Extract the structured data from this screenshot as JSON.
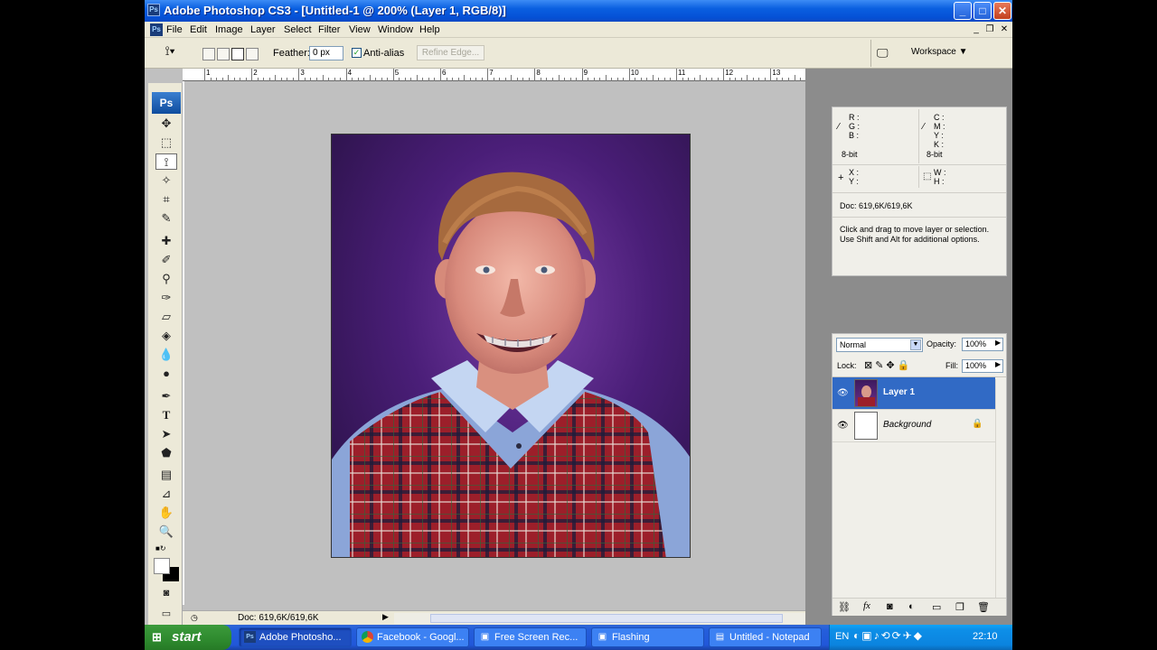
{
  "window": {
    "title": "Adobe Photoshop CS3 - [Untitled-1 @ 200% (Layer 1, RGB/8)]",
    "app_icon": "Ps",
    "minimize": "_",
    "maximize": "□",
    "close": "✕"
  },
  "menu": {
    "items": [
      "File",
      "Edit",
      "Image",
      "Layer",
      "Select",
      "Filter",
      "View",
      "Window",
      "Help"
    ],
    "doc_controls": [
      "_",
      "❐",
      "✕"
    ]
  },
  "options": {
    "feather_label": "Feather:",
    "feather_value": "0 px",
    "antialias_label": "Anti-alias",
    "antialias_checked": true,
    "refine_edge": "Refine Edge...",
    "workspace": "Workspace ▼"
  },
  "ruler": {
    "ticks": [
      "1",
      "2",
      "3",
      "4",
      "5",
      "6",
      "7",
      "8",
      "9",
      "10",
      "11",
      "12",
      "13"
    ]
  },
  "toolbox": {
    "logo": "Ps",
    "tools": [
      "move-tool",
      "marquee-tool",
      "polygonal-lasso-tool",
      "magic-wand-tool",
      "crop-tool",
      "slice-tool",
      "healing-brush-tool",
      "brush-tool",
      "clone-stamp-tool",
      "history-brush-tool",
      "eraser-tool",
      "paint-bucket-tool",
      "blur-tool",
      "dodge-tool",
      "pen-tool",
      "type-tool",
      "path-selection-tool",
      "shape-tool",
      "notes-tool",
      "eyedropper-tool",
      "hand-tool",
      "zoom-tool"
    ]
  },
  "document": {
    "status": "Doc: 619,6K/619,6K"
  },
  "info_panel": {
    "rgb_labels": [
      "R :",
      "G :",
      "B :"
    ],
    "cmyk_labels": [
      "C :",
      "M :",
      "Y :",
      "K :"
    ],
    "bit_left": "8-bit",
    "bit_right": "8-bit",
    "xy_labels": [
      "X :",
      "Y :"
    ],
    "wh_labels": [
      "W :",
      "H :"
    ],
    "doc": "Doc: 619,6K/619,6K",
    "hint": "Click and drag to move layer or selection.  Use Shift and Alt for additional options."
  },
  "layers_panel": {
    "blend_mode": "Normal",
    "opacity_label": "Opacity:",
    "opacity": "100%",
    "lock_label": "Lock:",
    "fill_label": "Fill:",
    "fill": "100%",
    "layers": [
      {
        "name": "Layer 1",
        "selected": true
      },
      {
        "name": "Background",
        "selected": false,
        "locked": true
      }
    ]
  },
  "taskbar": {
    "start": "start",
    "tasks": [
      {
        "label": "Adobe Photosho...",
        "active": true,
        "icon": "photoshop-icon"
      },
      {
        "label": "Facebook - Googl...",
        "active": false,
        "icon": "chrome-icon"
      },
      {
        "label": "Free Screen Rec...",
        "active": false,
        "icon": "recorder-icon"
      },
      {
        "label": "Flashing",
        "active": false,
        "icon": "recorder-icon"
      },
      {
        "label": "Untitled - Notepad",
        "active": false,
        "icon": "notepad-icon"
      }
    ],
    "lang": "EN",
    "clock": "22:10"
  },
  "colors": {
    "titlebar": "#0551d6",
    "taskbar": "#245edb",
    "start": "#2e8a2e",
    "layer_selected": "#316ac5"
  }
}
